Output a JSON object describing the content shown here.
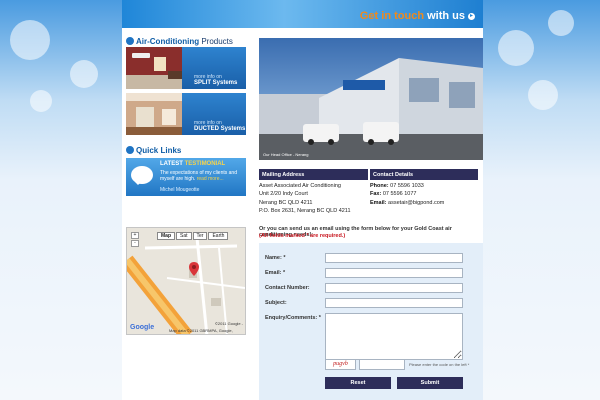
{
  "header": {
    "get_in_touch_part1": "Get in touch",
    "get_in_touch_part2": "with us",
    "arrow_icon": "arrow-circle-icon"
  },
  "sidebar": {
    "products_heading_bold": "Air-Conditioning",
    "products_heading_rest": "Products",
    "products": [
      {
        "more": "more info on",
        "name": "SPLIT Systems"
      },
      {
        "more": "more info on",
        "name": "DUCTED Systems"
      }
    ],
    "quick_links_heading": "Quick Links",
    "testimonial": {
      "title_part1": "LATEST",
      "title_part2": "TESTIMONIAL",
      "body": "The expectations of my clients and myself are high.",
      "read_more": "read more...",
      "author": "Michel Mougeotte"
    }
  },
  "map": {
    "tabs": [
      "Map",
      "Sat",
      "Ter",
      "Earth"
    ],
    "active_tab": "Map",
    "zoom_in": "+",
    "zoom_out": "-",
    "attribution": "©2011 Google -",
    "map_data": "Map data ©2011 GBRMPA, Google,",
    "logo": "Google"
  },
  "hero": {
    "caption": "Our Head Office - Nerang"
  },
  "mailing": {
    "heading": "Mailing Address",
    "lines": [
      "Asset Associated Air Conditioning",
      "Unit 2/20 Indy Court",
      "Nerang BC QLD 4211",
      "P.O. Box 2631, Nerang BC QLD 4211"
    ]
  },
  "contact": {
    "heading": "Contact Details",
    "phone_label": "Phone:",
    "phone": "07 5596 1033",
    "fax_label": "Fax:",
    "fax": "07 5596 1077",
    "email_label": "Email:",
    "email": "assetair@bigpond.com"
  },
  "form": {
    "intro": "Or you can send us an email using the form below for your Gold Coast air conditioning needs!:",
    "required_note": "(All fields marked * are required.)",
    "name_label": "Name: *",
    "email_label": "Email: *",
    "contact_label": "Contact Number:",
    "subject_label": "Subject:",
    "enquiry_label": "Enquiry/Comments: *",
    "captcha_code": "pugvb",
    "captcha_hint": "Please enter the code on the left *",
    "reset_label": "Reset",
    "submit_label": "Submit"
  },
  "colors": {
    "accent_orange": "#f08a1c",
    "brand_blue": "#1f86d8",
    "header_navy": "#2d2d5a",
    "required_red": "#c8141d",
    "form_bg": "#e3eef9"
  }
}
